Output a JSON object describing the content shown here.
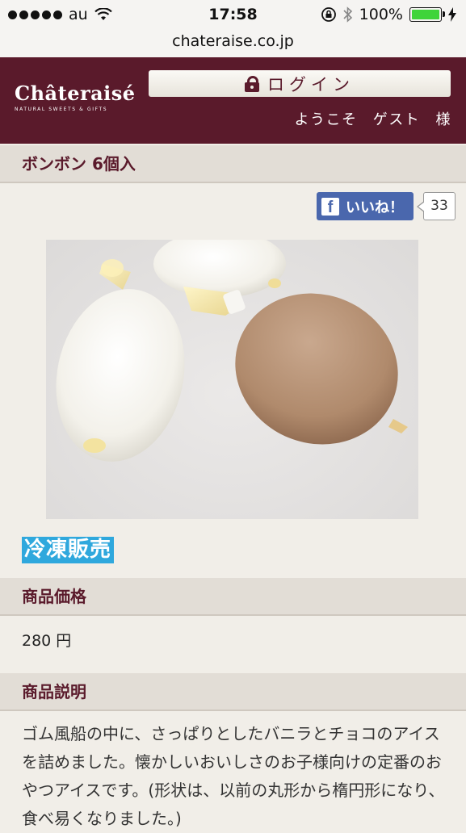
{
  "statusbar": {
    "carrier": "au",
    "time": "17:58",
    "battery": "100%"
  },
  "browser": {
    "url": "chateraise.co.jp"
  },
  "header": {
    "logo_main": "Châteraisé",
    "logo_sub": "NATURAL SWEETS & GIFTS",
    "login_label": "ログイン",
    "welcome": "ようこそ ゲスト 様"
  },
  "product": {
    "title": "ボンボン 6個入",
    "like_label": "いいね！",
    "like_count": "33",
    "badge": "冷凍販売",
    "price_heading": "商品価格",
    "price": "280 円",
    "desc_heading": "商品説明",
    "description": "ゴム風船の中に、さっぱりとしたバニラとチョコのアイスを詰めました。懐かしいおいしさのお子様向けの定番のおやつアイスです。(形状は、以前の丸形から楕円形になり、食べ易くなりました。)"
  },
  "colors": {
    "brand": "#5a1a2b",
    "badge": "#2fa8dd",
    "facebook": "#4a67ad"
  }
}
